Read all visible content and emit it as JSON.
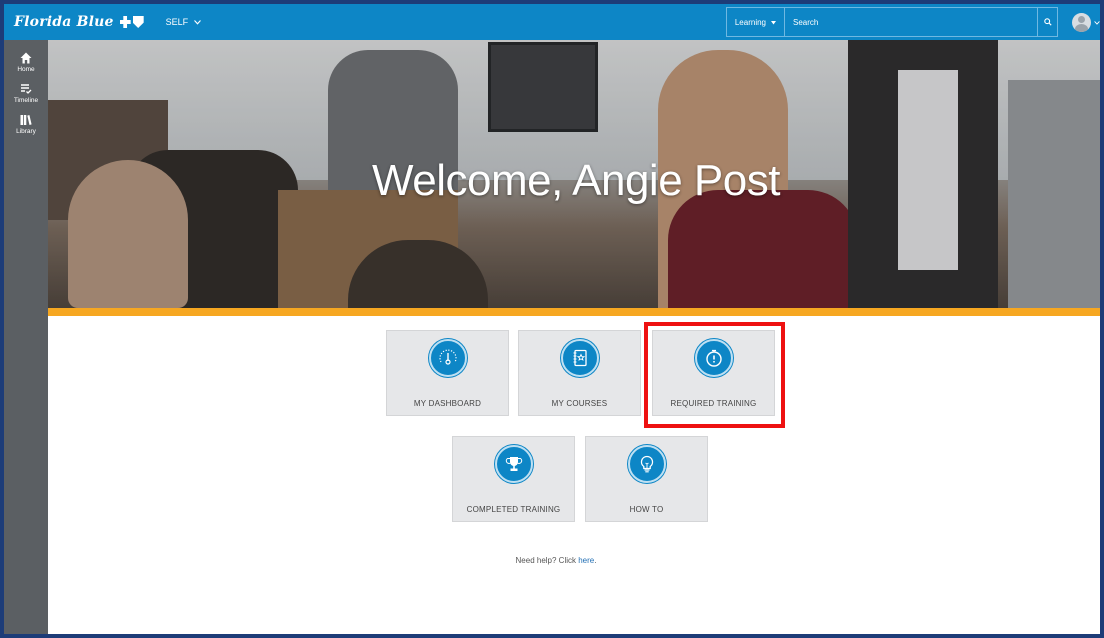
{
  "header": {
    "brand": "Florida Blue",
    "context_menu": "SELF",
    "learning_menu": "Learning",
    "search_placeholder": "Search"
  },
  "sidebar": {
    "items": [
      {
        "label": "Home",
        "icon": "home-icon"
      },
      {
        "label": "Timeline",
        "icon": "timeline-icon"
      },
      {
        "label": "Library",
        "icon": "library-icon"
      }
    ]
  },
  "hero": {
    "welcome": "Welcome, Angie Post"
  },
  "tiles": [
    {
      "label": "MY DASHBOARD",
      "icon": "gauge-icon"
    },
    {
      "label": "MY COURSES",
      "icon": "notebook-icon"
    },
    {
      "label": "REQUIRED TRAINING",
      "icon": "stopwatch-icon"
    },
    {
      "label": "COMPLETED TRAINING",
      "icon": "trophy-icon"
    },
    {
      "label": "HOW TO",
      "icon": "lightbulb-icon"
    }
  ],
  "help": {
    "text": "Need help? Click ",
    "link": "here",
    "suffix": "."
  },
  "colors": {
    "topbar": "#0d86c6",
    "sidebar": "#5b5f63",
    "accent_bar": "#f6a721",
    "highlight": "#ee1111",
    "tile_bg": "#e6e7e9"
  }
}
